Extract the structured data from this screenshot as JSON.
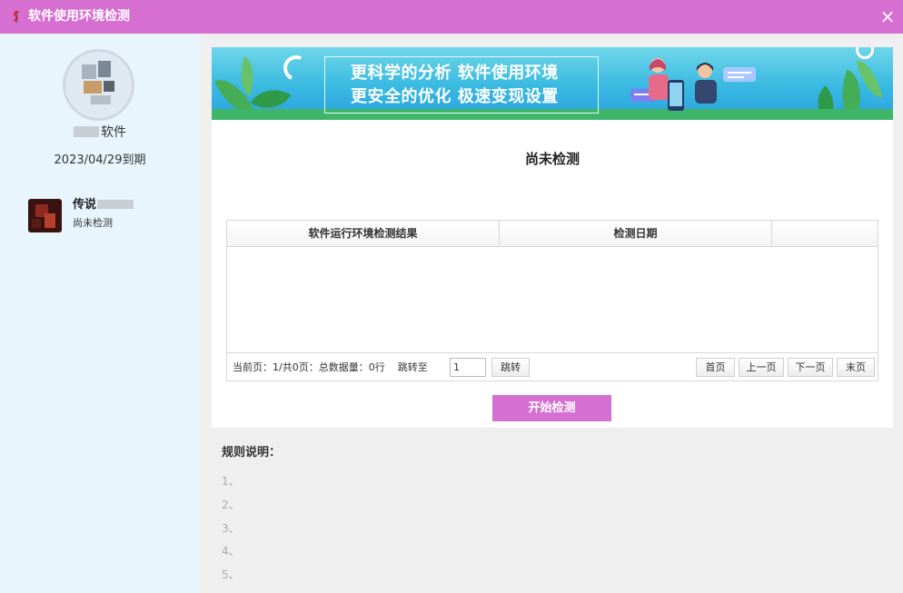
{
  "window": {
    "title": "软件使用环境检测",
    "close_icon": "×",
    "colors": {
      "titlebar": "#d66fd1",
      "sidebar": "#e8f5fd",
      "accent_button": "#d56fd1"
    }
  },
  "sidebar": {
    "software_suffix": "软件",
    "expiry": "2023/04/29到期",
    "items": [
      {
        "name": "传说",
        "status": "尚未检测"
      }
    ]
  },
  "banner": {
    "line1": "更科学的分析 软件使用环境",
    "line2": "更安全的优化 极速变现设置"
  },
  "main": {
    "status_title": "尚未检测",
    "table": {
      "columns": [
        "软件运行环境检测结果",
        "检测日期",
        ""
      ],
      "rows": []
    },
    "pager": {
      "info": "当前页：1/共0页：总数据量：0行",
      "jump_label": "跳转至",
      "jump_value": "1",
      "jump_button": "跳转",
      "first": "首页",
      "prev": "上一页",
      "next": "下一页",
      "last": "末页"
    },
    "start_button": "开始检测"
  },
  "rules": {
    "title": "规则说明：",
    "items": [
      "1、",
      "2、",
      "3、",
      "4、",
      "5、"
    ]
  }
}
